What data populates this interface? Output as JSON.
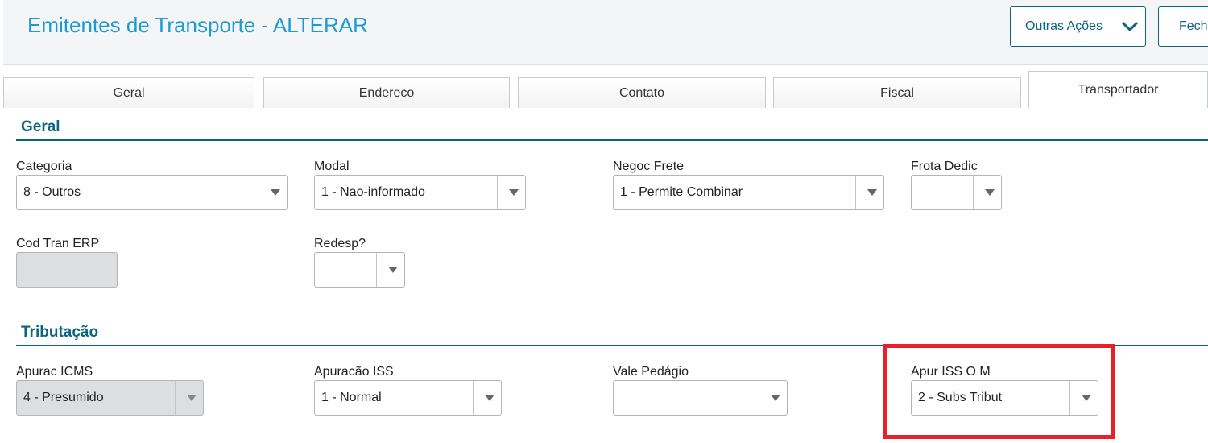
{
  "header": {
    "title": "Emitentes de Transporte - ALTERAR",
    "more_actions_label": "Outras Ações",
    "close_label": "Fech"
  },
  "tabs": [
    {
      "label": "Geral",
      "active": false
    },
    {
      "label": "Endereco",
      "active": false
    },
    {
      "label": "Contato",
      "active": false
    },
    {
      "label": "Fiscal",
      "active": false
    },
    {
      "label": "Transportador",
      "active": true
    }
  ],
  "sections": {
    "geral": {
      "title": "Geral",
      "fields": {
        "categoria": {
          "label": "Categoria",
          "value": "8 - Outros"
        },
        "modal": {
          "label": "Modal",
          "value": "1 - Nao-informado"
        },
        "negoc_frete": {
          "label": "Negoc Frete",
          "value": "1 - Permite Combinar"
        },
        "frota_dedic": {
          "label": "Frota Dedic",
          "value": ""
        },
        "cod_tran_erp": {
          "label": "Cod Tran ERP",
          "value": ""
        },
        "redesp": {
          "label": "Redesp?",
          "value": ""
        }
      }
    },
    "tributacao": {
      "title": "Tributação",
      "fields": {
        "apurac_icms": {
          "label": "Apurac ICMS",
          "value": "4 - Presumido"
        },
        "apuracao_iss": {
          "label": "Apuracão ISS",
          "value": "1 - Normal"
        },
        "vale_pedagio": {
          "label": "Vale Pedágio",
          "value": ""
        },
        "apur_iss_om": {
          "label": "Apur ISS O M",
          "value": "2 - Subs Tribut"
        }
      }
    }
  },
  "colors": {
    "title": "#1d9bd1",
    "accent": "#0c6580",
    "highlight": "#e8202a",
    "disabled_field": "#dcdedf"
  }
}
